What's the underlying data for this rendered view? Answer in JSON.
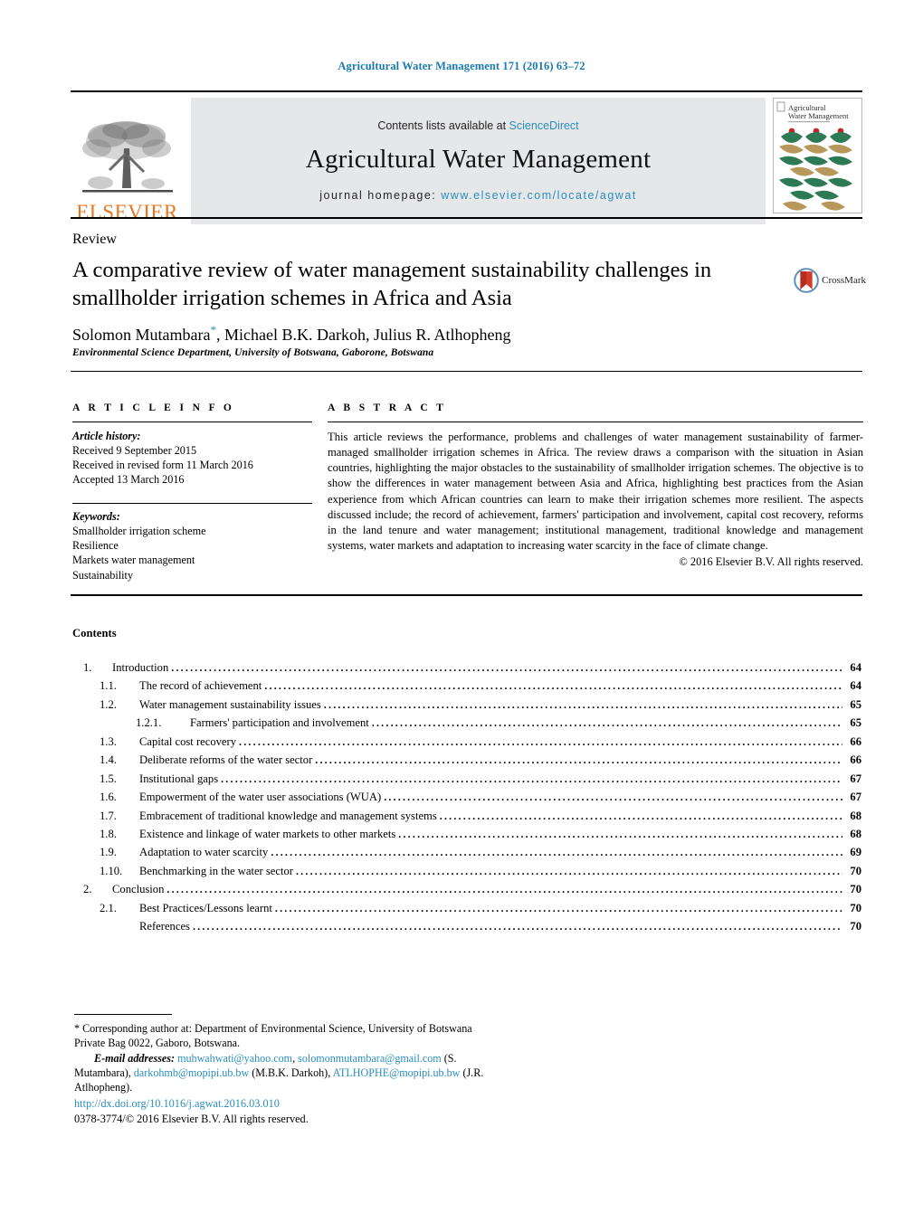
{
  "running_head": "Agricultural Water Management 171 (2016) 63–72",
  "masthead": {
    "publisher_name": "ELSEVIER",
    "contents_prefix": "Contents lists available at ",
    "contents_link": "ScienceDirect",
    "journal_title": "Agricultural Water Management",
    "homepage_prefix": "journal homepage: ",
    "homepage_url": "www.elsevier.com/locate/agwat",
    "cover_title_line1": "Agricultural",
    "cover_title_line2": "Water Management"
  },
  "article": {
    "doctype": "Review",
    "title": "A comparative review of water management sustainability challenges in smallholder irrigation schemes in Africa and Asia",
    "authors": "Solomon Mutambara",
    "authors_rest": ", Michael B.K. Darkoh, Julius R. Atlhopheng",
    "affiliation": "Environmental Science Department, University of Botswana, Gaborone, Botswana",
    "crossmark_label": "CrossMark"
  },
  "article_info": {
    "heading": "A R T I C L E   I N F O",
    "history_label": "Article history:",
    "history": [
      "Received 9 September 2015",
      "Received in revised form 11 March 2016",
      "Accepted 13 March 2016"
    ],
    "keywords_label": "Keywords:",
    "keywords": [
      "Smallholder irrigation scheme",
      "Resilience",
      "Markets water management",
      "Sustainability"
    ]
  },
  "abstract": {
    "heading": "A B S T R A C T",
    "body": "This article reviews the performance, problems and challenges of water management sustainability of farmer-managed smallholder irrigation schemes in Africa. The review draws a comparison with the situation in Asian countries, highlighting the major obstacles to the sustainability of smallholder irrigation schemes. The objective is to show the differences in water management between Asia and Africa, highlighting best practices from the Asian experience from which African countries can learn to make their irrigation schemes more resilient. The aspects discussed include; the record of achievement, farmers' participation and involvement, capital cost recovery, reforms in the land tenure and water management; institutional management, traditional knowledge and management systems, water markets and adaptation to increasing water scarcity in the face of climate change.",
    "copyright": "© 2016 Elsevier B.V. All rights reserved."
  },
  "contents": {
    "heading": "Contents",
    "entries": [
      {
        "num": "1.",
        "label": "Introduction",
        "page": "64",
        "level": "lvl1"
      },
      {
        "num": "1.1.",
        "label": "The record of achievement",
        "page": "64",
        "level": "lvl2"
      },
      {
        "num": "1.2.",
        "label": "Water management sustainability issues",
        "page": "65",
        "level": "lvl2"
      },
      {
        "num": "1.2.1.",
        "label": "Farmers' participation and involvement",
        "page": "65",
        "level": "lvl3"
      },
      {
        "num": "1.3.",
        "label": "Capital cost recovery",
        "page": "66",
        "level": "lvl2"
      },
      {
        "num": "1.4.",
        "label": "Deliberate reforms of the water sector",
        "page": "66",
        "level": "lvl2"
      },
      {
        "num": "1.5.",
        "label": "Institutional gaps",
        "page": "67",
        "level": "lvl2"
      },
      {
        "num": "1.6.",
        "label": "Empowerment of the water user associations (WUA)",
        "page": "67",
        "level": "lvl2"
      },
      {
        "num": "1.7.",
        "label": "Embracement of traditional knowledge and management systems",
        "page": "68",
        "level": "lvl2"
      },
      {
        "num": "1.8.",
        "label": "Existence and linkage of water markets to other markets",
        "page": "68",
        "level": "lvl2"
      },
      {
        "num": "1.9.",
        "label": "Adaptation to water scarcity",
        "page": "69",
        "level": "lvl2"
      },
      {
        "num": "1.10.",
        "label": "Benchmarking in the water sector",
        "page": "70",
        "level": "lvl2b"
      },
      {
        "num": "2.",
        "label": "Conclusion",
        "page": "70",
        "level": "lvl1"
      },
      {
        "num": "2.1.",
        "label": "Best Practices/Lessons learnt",
        "page": "70",
        "level": "lvl2"
      },
      {
        "num": "",
        "label": "References",
        "page": "70",
        "level": "lvl2"
      }
    ]
  },
  "footnote": {
    "corresponding": "* Corresponding author at: Department of Environmental Science, University of Botswana Private Bag 0022, Gaboro, Botswana.",
    "email_label": "E-mail addresses:",
    "email1": "muhwahwati@yahoo.com",
    "email2": "solomonmutambara@gmail.com",
    "email1_attrib": "(S. Mutambara),",
    "email3": "darkohmb@mopipi.ub.bw",
    "email3_attrib": "(M.B.K. Darkoh),",
    "email4": "ATLHOPHE@mopipi.ub.bw",
    "email4_attrib": "(J.R. Atlhopheng)."
  },
  "doi": {
    "url": "http://dx.doi.org/10.1016/j.agwat.2016.03.010",
    "issn_line": "0378-3774/© 2016 Elsevier B.V. All rights reserved."
  },
  "colors": {
    "link": "#2a8dbd",
    "elsevier_orange": "#E87722",
    "band_gray": "#e6e7e8",
    "cover_green": "#2f7a56",
    "cover_tan": "#b8985a",
    "cover_red": "#c0272d"
  }
}
